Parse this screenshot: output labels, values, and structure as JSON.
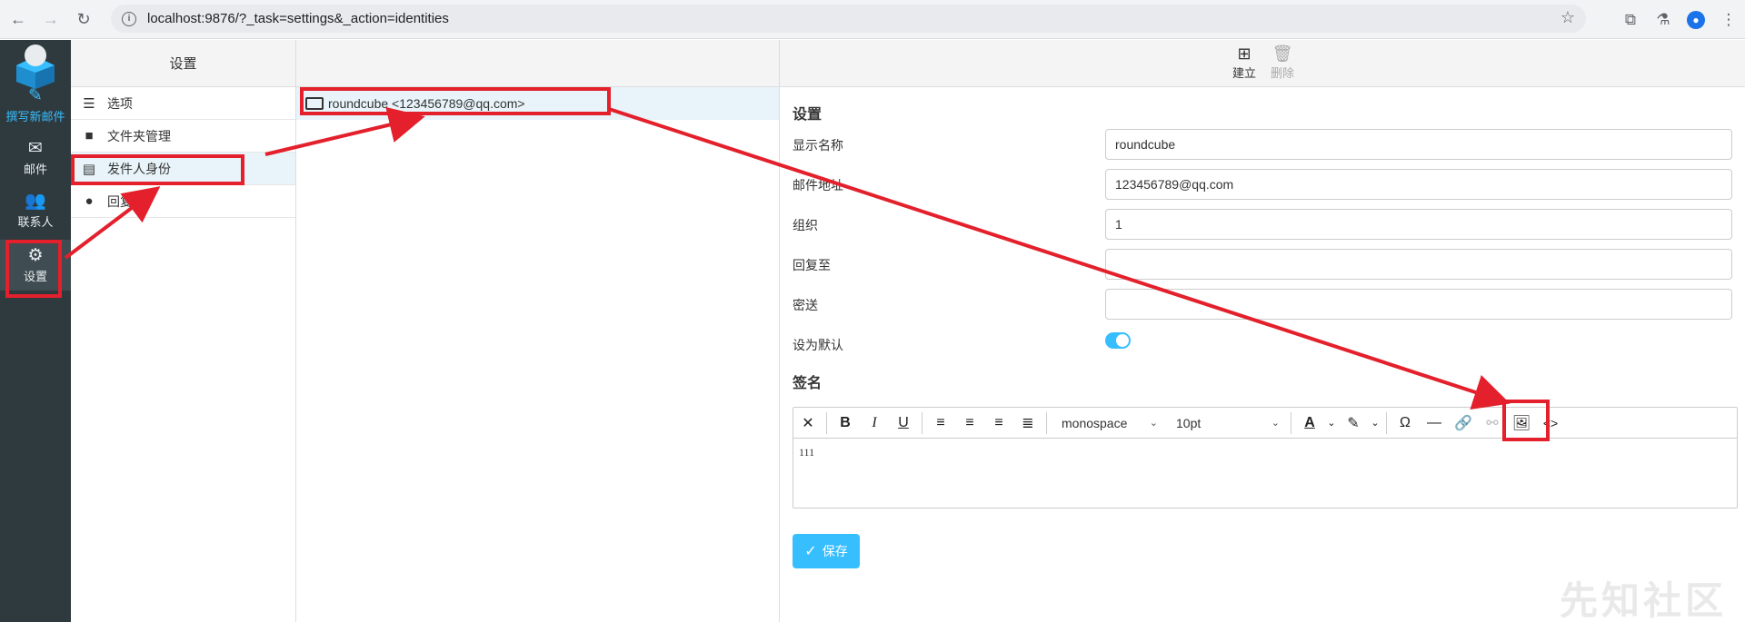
{
  "browser": {
    "url": "localhost:9876/?_task=settings&_action=identities",
    "nav_icons": [
      "back-arrow-icon",
      "forward-arrow-icon",
      "reload-icon"
    ],
    "right_icons": [
      "extensions-icon",
      "labs-icon",
      "profile-icon",
      "menu-icon"
    ]
  },
  "leftnav": {
    "items": [
      {
        "label": "撰写新邮件",
        "icon": "compose-icon",
        "color": "#37beff"
      },
      {
        "label": "邮件",
        "icon": "envelope-icon"
      },
      {
        "label": "联系人",
        "icon": "users-icon"
      },
      {
        "label": "设置",
        "icon": "gear-icon"
      }
    ]
  },
  "settings_menu": {
    "title": "设置",
    "items": [
      {
        "label": "选项",
        "icon": "sliders-icon"
      },
      {
        "label": "文件夹管理",
        "icon": "folder-icon"
      },
      {
        "label": "发件人身份",
        "icon": "id-card-icon"
      },
      {
        "label": "回复",
        "icon": "comment-icon"
      }
    ]
  },
  "identities": {
    "items": [
      {
        "label": "roundcube <123456789@qq.com>",
        "icon": "id-card-icon"
      }
    ]
  },
  "toolbar": {
    "create_label": "建立",
    "delete_label": "删除"
  },
  "form": {
    "section_title": "设置",
    "fields": [
      {
        "label": "显示名称",
        "value": "roundcube"
      },
      {
        "label": "邮件地址",
        "value": "123456789@qq.com"
      },
      {
        "label": "组织",
        "value": "1"
      },
      {
        "label": "回复至",
        "value": ""
      },
      {
        "label": "密送",
        "value": ""
      }
    ],
    "default_label": "设为默认",
    "default_on": true,
    "signature_title": "签名"
  },
  "editor": {
    "font_family": "monospace",
    "font_size": "10pt",
    "content": "111"
  },
  "save_label": "保存",
  "watermark": "先知社区",
  "colors": {
    "accent": "#37beff",
    "sidebar": "#2f3a3f",
    "annotation": "#e3202b"
  }
}
